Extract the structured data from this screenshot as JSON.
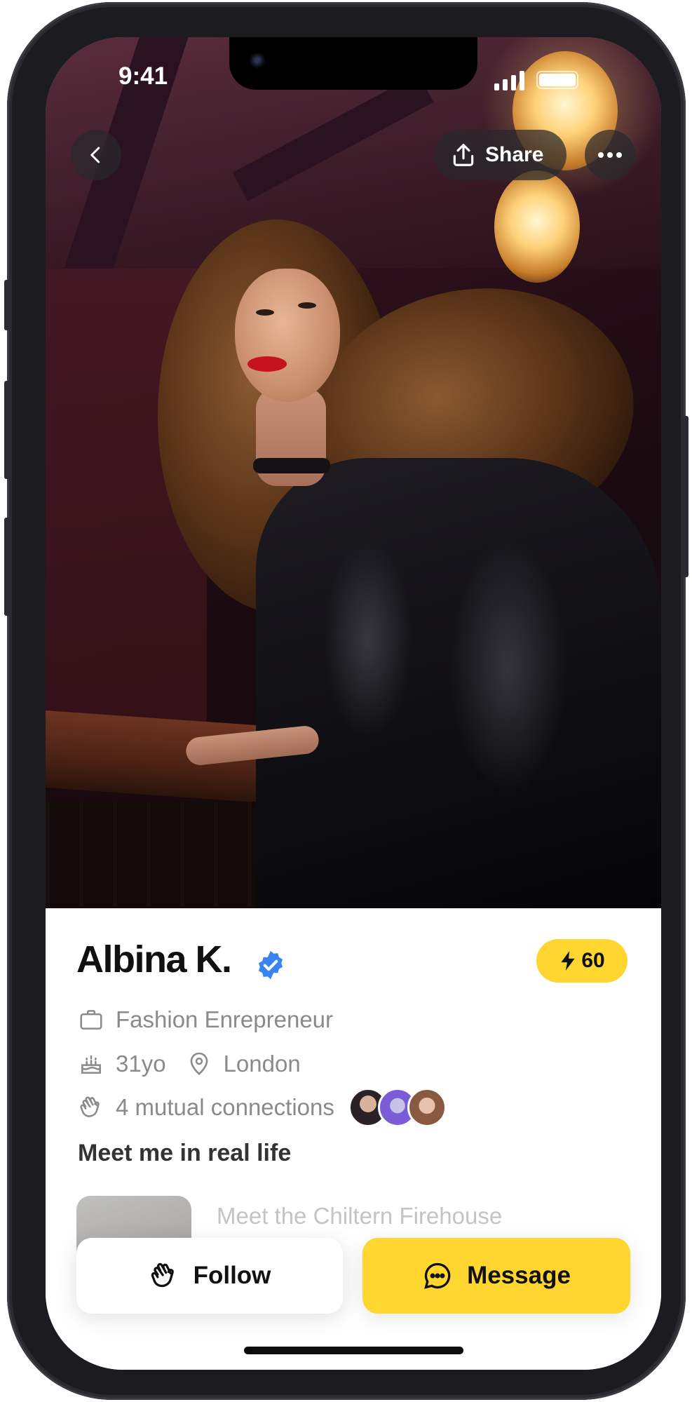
{
  "status_bar": {
    "time": "9:41"
  },
  "header": {
    "share_label": "Share"
  },
  "profile": {
    "name": "Albina K.",
    "points": "60",
    "occupation": "Fashion Enrepreneur",
    "age": "31yo",
    "location": "London",
    "mutual_connections": "4 mutual connections"
  },
  "section": {
    "title": "Meet me in real life",
    "event_title": "Meet the Chiltern Firehouse"
  },
  "actions": {
    "follow_label": "Follow",
    "message_label": "Message"
  },
  "colors": {
    "accent": "#FED62F",
    "verified": "#3B82F6",
    "muted_text": "#8A8A8E"
  }
}
